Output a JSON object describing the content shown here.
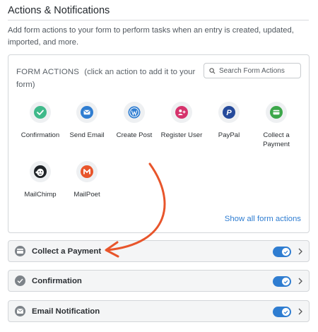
{
  "section": {
    "title": "Actions & Notifications",
    "description": "Add form actions to your form to perform tasks when an entry is created, updated, imported, and more."
  },
  "panel": {
    "heading_caps": "FORM ACTIONS",
    "heading_hint": "(click an action to add it to your form)",
    "search_placeholder": "Search Form Actions",
    "show_all": "Show all form actions",
    "actions": [
      {
        "label": "Confirmation",
        "icon": "check-circle-icon",
        "color": "#3fb98a"
      },
      {
        "label": "Send Email",
        "icon": "envelope-icon",
        "color": "#2f7dd1"
      },
      {
        "label": "Create Post",
        "icon": "wordpress-icon",
        "color": "#2f7dd1"
      },
      {
        "label": "Register User",
        "icon": "user-plus-icon",
        "color": "#d6336c"
      },
      {
        "label": "PayPal",
        "icon": "paypal-icon",
        "color": "#254a9b"
      },
      {
        "label": "Collect a Payment",
        "icon": "credit-card-icon",
        "color": "#3ca74a"
      },
      {
        "label": "MailChimp",
        "icon": "mailchimp-icon",
        "color": "#1f2327"
      },
      {
        "label": "MailPoet",
        "icon": "mailpoet-icon",
        "color": "#e8552b"
      }
    ]
  },
  "installed_actions": [
    {
      "label": "Collect a Payment",
      "icon": "credit-card-icon",
      "enabled": true
    },
    {
      "label": "Confirmation",
      "icon": "check-circle-icon",
      "enabled": true
    },
    {
      "label": "Email Notification",
      "icon": "envelope-icon",
      "enabled": true
    }
  ],
  "colors": {
    "accent": "#2f7dd1",
    "annotation_arrow": "#e8552b"
  }
}
